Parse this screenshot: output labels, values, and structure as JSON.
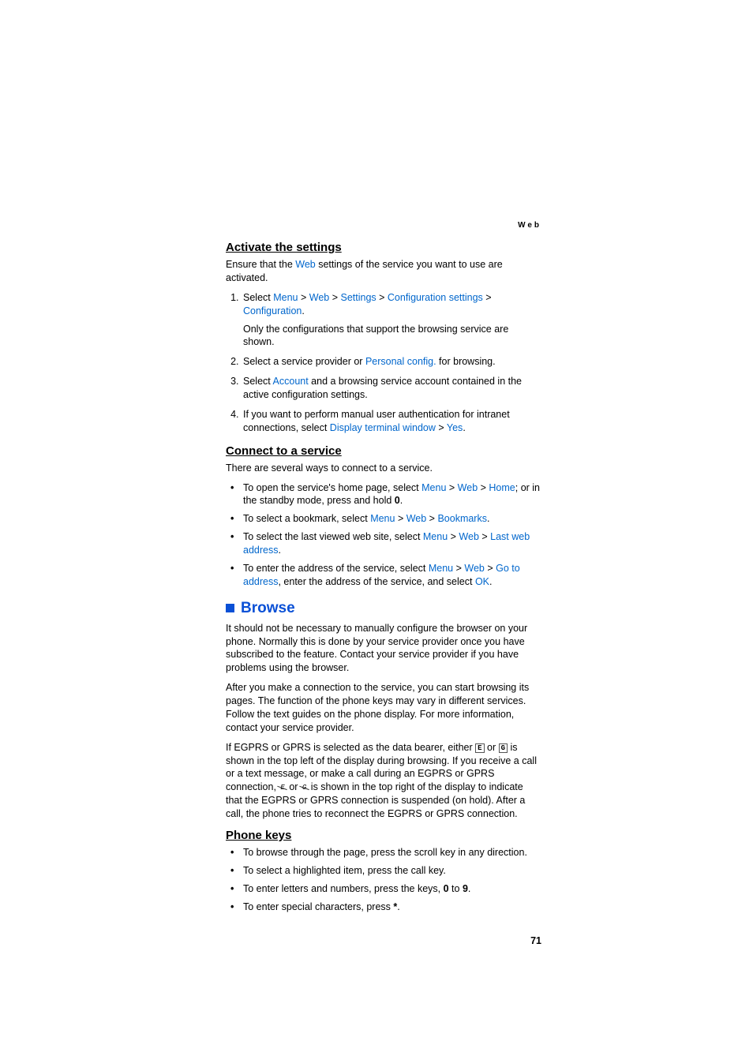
{
  "header": {
    "section": "Web"
  },
  "activate": {
    "heading": "Activate the settings",
    "intro_pre": "Ensure that the ",
    "intro_link": "Web",
    "intro_post": " settings of the service you want to use are activated.",
    "step1": {
      "pre": "Select ",
      "l1": "Menu",
      "s1": " > ",
      "l2": "Web",
      "s2": " > ",
      "l3": "Settings",
      "s3": " > ",
      "l4": "Configuration settings",
      "s4": " > ",
      "l5": "Configuration",
      "post": ".",
      "note": "Only the configurations that support the browsing service are shown."
    },
    "step2": {
      "pre": "Select a service provider or ",
      "l1": "Personal config.",
      "post": " for browsing."
    },
    "step3": {
      "pre": "Select ",
      "l1": "Account",
      "post": " and a browsing service account contained in the active configuration settings."
    },
    "step4": {
      "pre": "If you want to perform manual user authentication for intranet connections, select ",
      "l1": "Display terminal window",
      "s1": " > ",
      "l2": "Yes",
      "post": "."
    }
  },
  "connect": {
    "heading": "Connect to a service",
    "intro": "There are several ways to connect to a service.",
    "b1": {
      "pre": "To open the service's home page, select ",
      "l1": "Menu",
      "s1": " > ",
      "l2": "Web",
      "s2": " > ",
      "l3": "Home",
      "mid": "; or in the standby mode, press and hold ",
      "key": "0",
      "post": "."
    },
    "b2": {
      "pre": "To select a bookmark, select ",
      "l1": "Menu",
      "s1": " > ",
      "l2": "Web",
      "s2": " > ",
      "l3": "Bookmarks",
      "post": "."
    },
    "b3": {
      "pre": "To select the last viewed web site, select ",
      "l1": "Menu",
      "s1": " > ",
      "l2": "Web",
      "s2": " > ",
      "l3": "Last web address",
      "post": "."
    },
    "b4": {
      "pre": "To enter the address of the service, select ",
      "l1": "Menu",
      "s1": " > ",
      "l2": "Web",
      "s2": " > ",
      "l3": "Go to address",
      "mid": ", enter the address of the service, and select ",
      "l4": "OK",
      "post": "."
    }
  },
  "browse": {
    "heading": "Browse",
    "p1": "It should not be necessary to manually configure the browser on your phone. Normally this is done by your service provider once you have subscribed to the feature. Contact your service provider if you have problems using the browser.",
    "p2": "After you make a connection to the service, you can start browsing its pages. The function of the phone keys may vary in different services. Follow the text guides on the phone display. For more information, contact your service provider.",
    "p3a": "If EGPRS or GPRS is selected as the data bearer, either ",
    "icon1": "E",
    "p3b": " or ",
    "icon2": "G",
    "p3c": " is shown in the top left of the display during browsing. If you receive a call or a text message, or make a call during an EGPRS or GPRS connection, ",
    "icon3": "E",
    "p3d": " or ",
    "icon4": "G",
    "p3e": " is shown in the top right of the display to indicate that the EGPRS or GPRS connection is suspended (on hold). After a call, the phone tries to reconnect the EGPRS or GPRS connection."
  },
  "phonekeys": {
    "heading": "Phone keys",
    "b1": "To browse through the page, press the scroll key in any direction.",
    "b2": "To select a highlighted item, press the call key.",
    "b3_pre": "To enter letters and numbers, press the keys, ",
    "b3_k1": "0",
    "b3_mid": " to ",
    "b3_k2": "9",
    "b3_post": ".",
    "b4_pre": "To enter special characters, press ",
    "b4_key": "*",
    "b4_post": "."
  },
  "page_number": "71"
}
